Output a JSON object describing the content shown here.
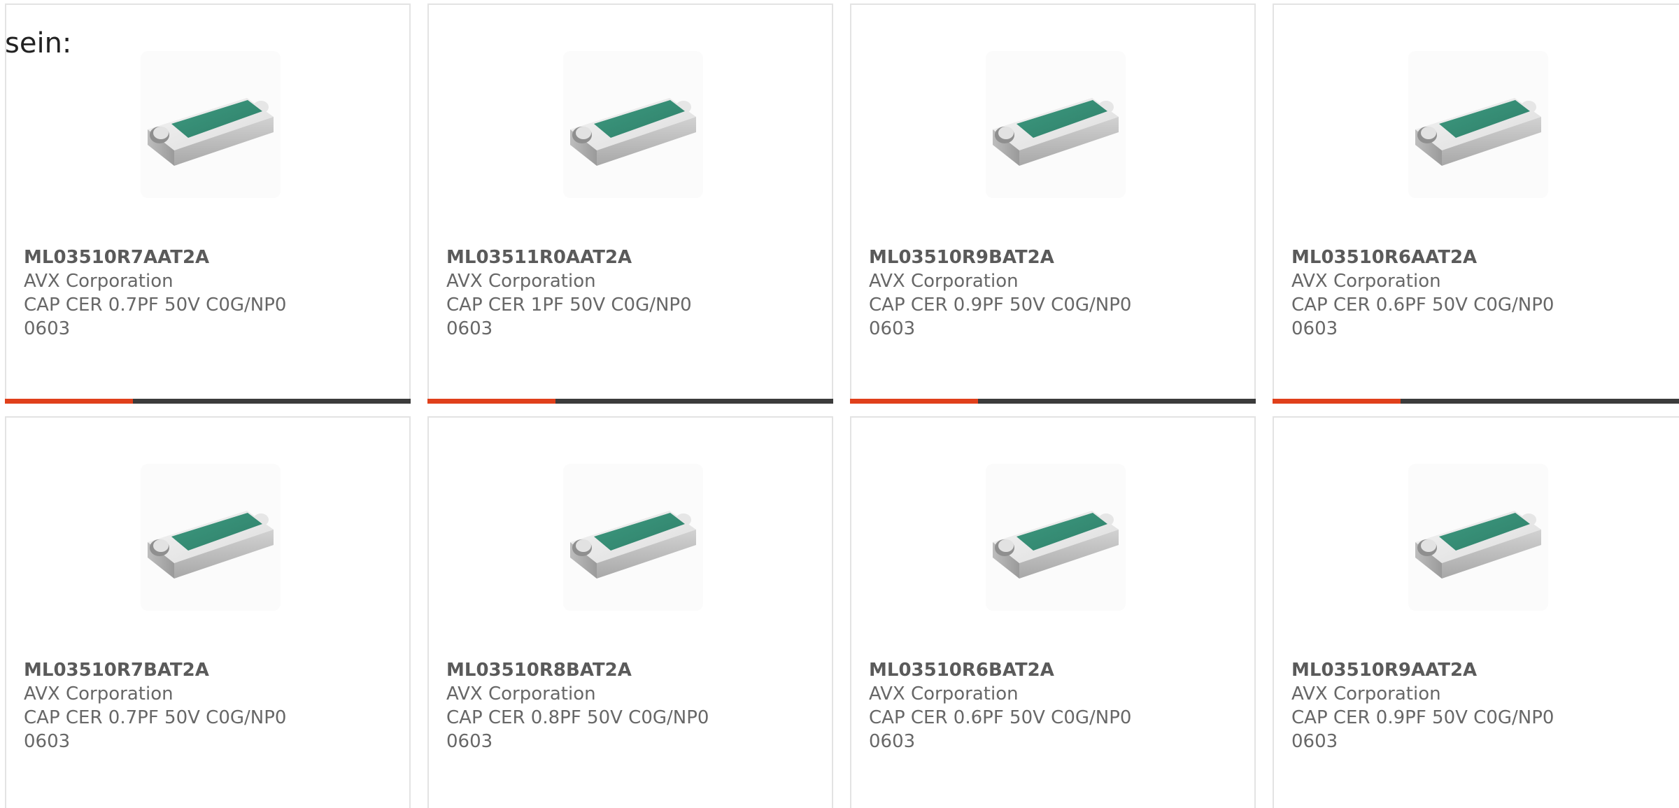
{
  "intro_text": "sein:",
  "accent_color": "#e0401b",
  "products": [
    {
      "part_number": "ML03510R7AAT2A",
      "manufacturer": "AVX Corporation",
      "description": "CAP CER 0.7PF 50V C0G/NP0 0603",
      "image_icon": "smd-chip-capacitor-icon"
    },
    {
      "part_number": "ML03511R0AAT2A",
      "manufacturer": "AVX Corporation",
      "description": "CAP CER 1PF 50V C0G/NP0 0603",
      "image_icon": "smd-chip-capacitor-icon"
    },
    {
      "part_number": "ML03510R9BAT2A",
      "manufacturer": "AVX Corporation",
      "description": "CAP CER 0.9PF 50V C0G/NP0 0603",
      "image_icon": "smd-chip-capacitor-icon"
    },
    {
      "part_number": "ML03510R6AAT2A",
      "manufacturer": "AVX Corporation",
      "description": "CAP CER 0.6PF 50V C0G/NP0 0603",
      "image_icon": "smd-chip-capacitor-icon"
    },
    {
      "part_number": "ML03510R7BAT2A",
      "manufacturer": "AVX Corporation",
      "description": "CAP CER 0.7PF 50V C0G/NP0 0603",
      "image_icon": "smd-chip-capacitor-icon"
    },
    {
      "part_number": "ML03510R8BAT2A",
      "manufacturer": "AVX Corporation",
      "description": "CAP CER 0.8PF 50V C0G/NP0 0603",
      "image_icon": "smd-chip-capacitor-icon"
    },
    {
      "part_number": "ML03510R6BAT2A",
      "manufacturer": "AVX Corporation",
      "description": "CAP CER 0.6PF 50V C0G/NP0 0603",
      "image_icon": "smd-chip-capacitor-icon"
    },
    {
      "part_number": "ML03510R9AAT2A",
      "manufacturer": "AVX Corporation",
      "description": "CAP CER 0.9PF 50V C0G/NP0 0603",
      "image_icon": "smd-chip-capacitor-icon"
    }
  ]
}
